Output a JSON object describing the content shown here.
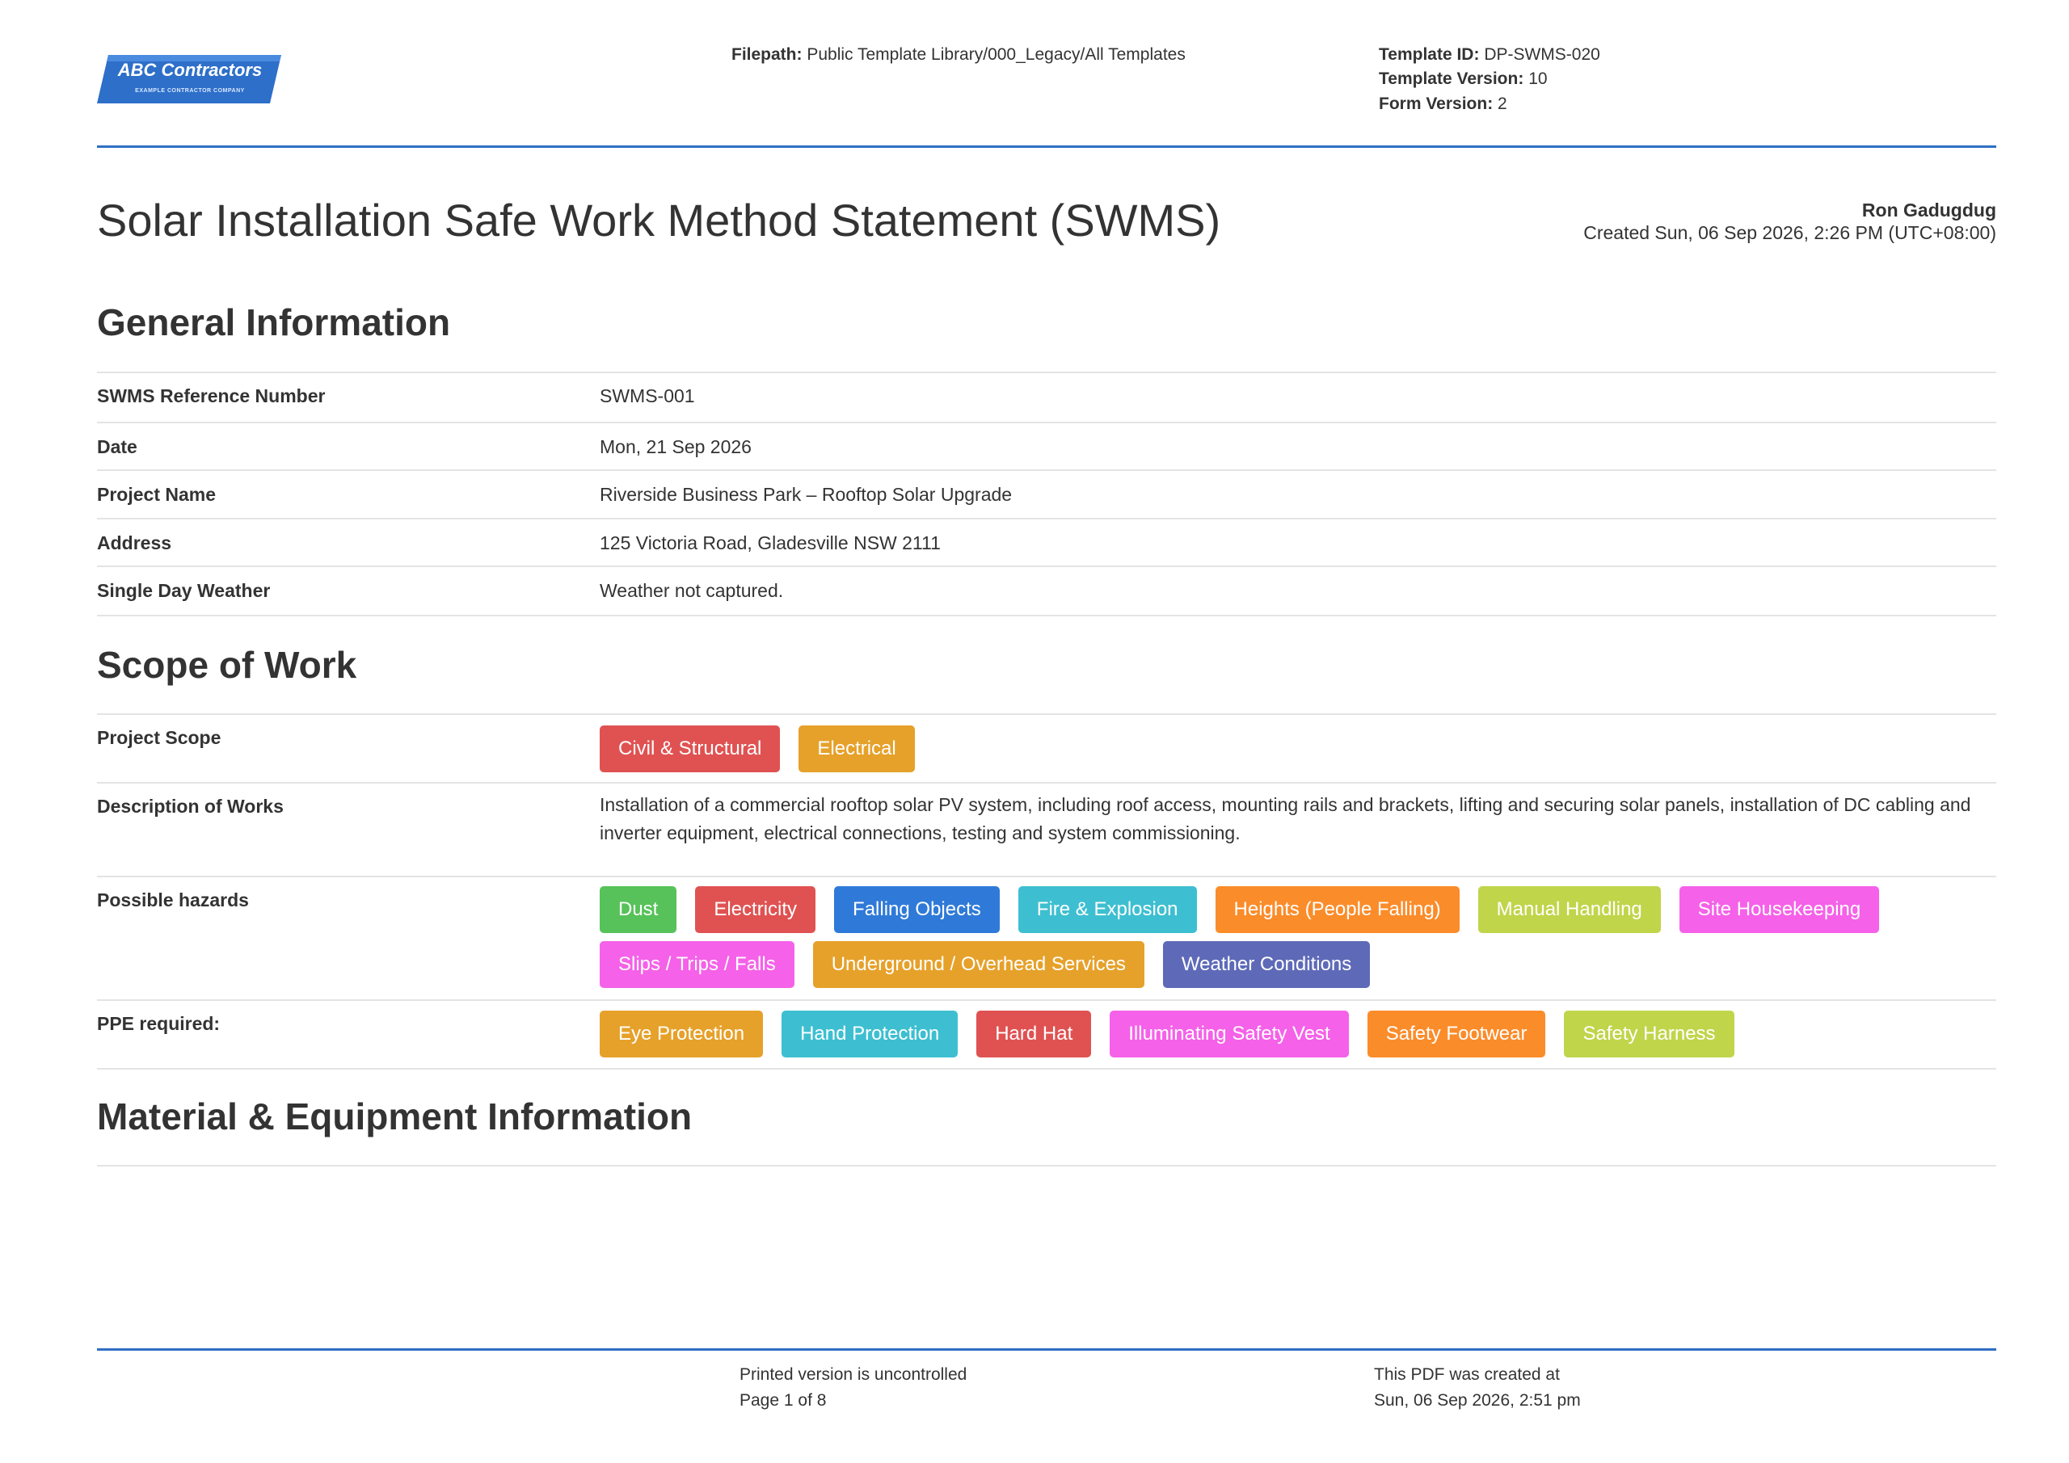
{
  "header": {
    "logo": {
      "name": "ABC Contractors",
      "tagline": "EXAMPLE CONTRACTOR COMPANY",
      "color": "#2d6fc9"
    },
    "filepath_label": "Filepath:",
    "filepath_value": "Public Template Library/000_Legacy/All Templates",
    "template_id_label": "Template ID:",
    "template_id_value": "DP-SWMS-020",
    "template_version_label": "Template Version:",
    "template_version_value": "10",
    "form_version_label": "Form Version:",
    "form_version_value": "2",
    "rule_color": "#2f6fc4"
  },
  "document": {
    "title": "Solar Installation Safe Work Method Statement (SWMS)",
    "author": "Ron Gadugdug",
    "created": "Created Sun, 06 Sep 2026, 2:26 PM (UTC+08:00)"
  },
  "general_information": {
    "heading": "General Information",
    "fields": [
      {
        "label": "SWMS Reference Number",
        "value": "SWMS-001"
      },
      {
        "label": "Date",
        "value": "Mon, 21 Sep 2026"
      },
      {
        "label": "Project Name",
        "value": "Riverside Business Park – Rooftop Solar Upgrade"
      },
      {
        "label": "Address",
        "value": "125 Victoria Road, Gladesville NSW 2111"
      },
      {
        "label": "Single Day Weather",
        "value": "Weather not captured."
      }
    ]
  },
  "scope_of_work": {
    "heading": "Scope of Work",
    "project_scope": {
      "label": "Project Scope",
      "tags": [
        {
          "text": "Civil & Structural",
          "color": "#e05252"
        },
        {
          "text": "Electrical",
          "color": "#e6a12a"
        }
      ]
    },
    "description": {
      "label": "Description of Works",
      "value": "Installation of a commercial rooftop solar PV system, including roof access, mounting rails and brackets, lifting and securing solar panels, installation of DC cabling and inverter equipment, electrical connections, testing and system commissioning."
    },
    "hazards": {
      "label": "Possible hazards",
      "tags": [
        {
          "text": "Dust",
          "color": "#57c25a"
        },
        {
          "text": "Electricity",
          "color": "#e05252"
        },
        {
          "text": "Falling Objects",
          "color": "#2f7ad8"
        },
        {
          "text": "Fire & Explosion",
          "color": "#3dbfd1"
        },
        {
          "text": "Heights (People Falling)",
          "color": "#fb8c2a"
        },
        {
          "text": "Manual Handling",
          "color": "#c0d54a"
        },
        {
          "text": "Site Housekeeping",
          "color": "#f561e8"
        },
        {
          "text": "Slips / Trips / Falls",
          "color": "#f561e8"
        },
        {
          "text": "Underground / Overhead Services",
          "color": "#e6a12a"
        },
        {
          "text": "Weather Conditions",
          "color": "#5e6ab8"
        }
      ]
    },
    "ppe": {
      "label": "PPE required:",
      "tags": [
        {
          "text": "Eye Protection",
          "color": "#e6a12a"
        },
        {
          "text": "Hand Protection",
          "color": "#3dbfd1"
        },
        {
          "text": "Hard Hat",
          "color": "#e05252"
        },
        {
          "text": "Illuminating Safety Vest",
          "color": "#f561e8"
        },
        {
          "text": "Safety Footwear",
          "color": "#fb8c2a"
        },
        {
          "text": "Safety Harness",
          "color": "#c0d54a"
        }
      ]
    }
  },
  "material_equipment": {
    "heading": "Material & Equipment Information"
  },
  "footer": {
    "uncontrolled": "Printed version is uncontrolled",
    "page": "Page 1 of 8",
    "pdf_created_label": "This PDF was created at",
    "pdf_created_value": "Sun, 06 Sep 2026, 2:51 pm"
  }
}
